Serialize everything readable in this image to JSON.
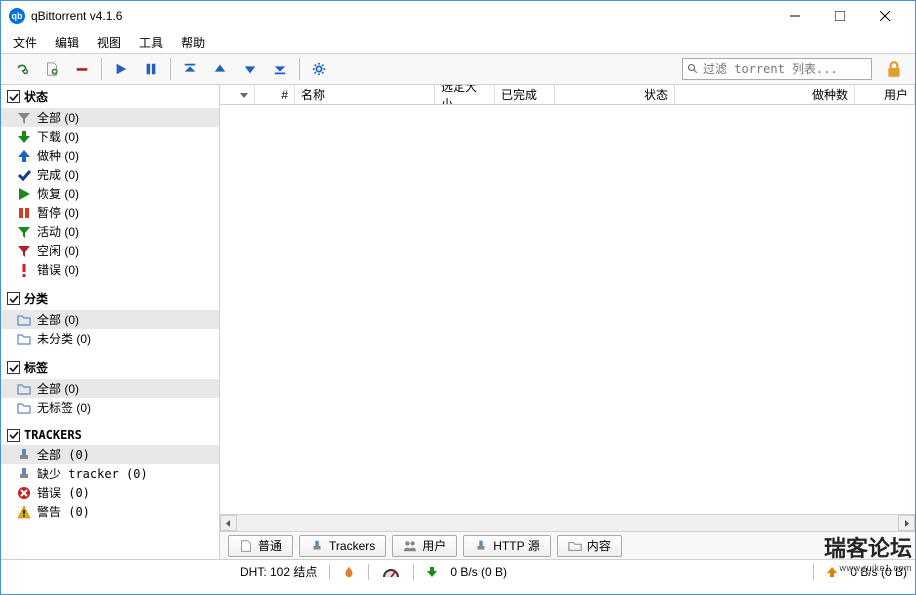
{
  "app": {
    "title": "qBittorrent v4.1.6",
    "icon_label": "qb"
  },
  "menu": {
    "file": "文件",
    "edit": "编辑",
    "view": "视图",
    "tools": "工具",
    "help": "帮助"
  },
  "search": {
    "placeholder": "过滤 torrent 列表..."
  },
  "sidebar": {
    "status": {
      "title": "状态",
      "items": [
        {
          "label": "全部 (0)",
          "icon": "funnel-gray",
          "selected": true
        },
        {
          "label": "下载 (0)",
          "icon": "arrow-down-green"
        },
        {
          "label": "做种 (0)",
          "icon": "arrow-up-blue"
        },
        {
          "label": "完成 (0)",
          "icon": "check-blue"
        },
        {
          "label": "恢复 (0)",
          "icon": "play-green"
        },
        {
          "label": "暂停 (0)",
          "icon": "pause-red"
        },
        {
          "label": "活动 (0)",
          "icon": "funnel-green"
        },
        {
          "label": "空闲 (0)",
          "icon": "funnel-red"
        },
        {
          "label": "错误 (0)",
          "icon": "bang-red"
        }
      ]
    },
    "category": {
      "title": "分类",
      "items": [
        {
          "label": "全部 (0)",
          "icon": "folder",
          "selected": true
        },
        {
          "label": "未分类 (0)",
          "icon": "folder"
        }
      ]
    },
    "tags": {
      "title": "标签",
      "items": [
        {
          "label": "全部 (0)",
          "icon": "folder",
          "selected": true
        },
        {
          "label": "无标签 (0)",
          "icon": "folder"
        }
      ]
    },
    "trackers": {
      "title": "TRACKERS",
      "items": [
        {
          "label": "全部 (0)",
          "icon": "tracker",
          "selected": true
        },
        {
          "label": "缺少 tracker (0)",
          "icon": "tracker"
        },
        {
          "label": "错误 (0)",
          "icon": "error-circle"
        },
        {
          "label": "警告 (0)",
          "icon": "warn-triangle"
        }
      ]
    }
  },
  "columns": {
    "num": "#",
    "name": "名称",
    "size": "选定大小",
    "done": "已完成",
    "status": "状态",
    "seeds": "做种数",
    "peers": "用户"
  },
  "tabs": {
    "general": "普通",
    "trackers": "Trackers",
    "peers": "用户",
    "http": "HTTP 源",
    "content": "内容"
  },
  "status": {
    "dht": "DHT: 102 结点",
    "down": "0  B/s (0  B)",
    "up": "0  B/s (0  B)"
  },
  "watermark": {
    "main": "瑞客论坛",
    "sub": "www.ruike1.com"
  }
}
